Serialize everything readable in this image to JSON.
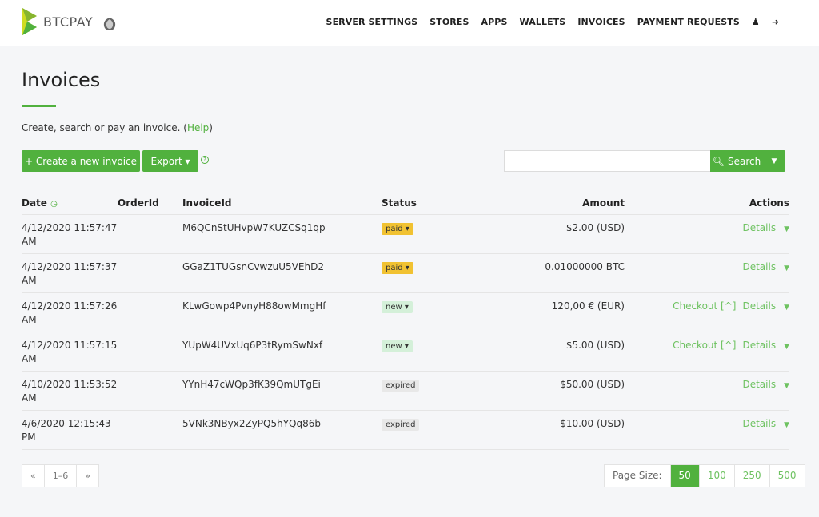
{
  "brand": {
    "name": "BTCPAY"
  },
  "nav": {
    "items": [
      "SERVER SETTINGS",
      "STORES",
      "APPS",
      "WALLETS",
      "INVOICES",
      "PAYMENT REQUESTS"
    ]
  },
  "page": {
    "title": "Invoices",
    "lead": "Create, search or pay an invoice. (",
    "help": "Help",
    "lead_end": ")"
  },
  "toolbar": {
    "create_label": "+ Create a new invoice",
    "export_label": "Export ▾",
    "help_icon": "?",
    "search_label": "Search",
    "search_value": ""
  },
  "table": {
    "headers": {
      "date": "Date",
      "order": "OrderId",
      "invoice": "InvoiceId",
      "status": "Status",
      "amount": "Amount",
      "actions": "Actions"
    },
    "rows": [
      {
        "date": "4/12/2020 11:57:47 AM",
        "order": "",
        "invoice": "M6QCnStUHvpW7KUZCSq1qp",
        "status": "paid",
        "amount": "$2.00 (USD)",
        "checkout": "",
        "details": "Details"
      },
      {
        "date": "4/12/2020 11:57:37 AM",
        "order": "",
        "invoice": "GGaZ1TUGsnCvwzuU5VEhD2",
        "status": "paid",
        "amount": "0.01000000 BTC",
        "checkout": "",
        "details": "Details"
      },
      {
        "date": "4/12/2020 11:57:26 AM",
        "order": "",
        "invoice": "KLwGowp4PvnyH88owMmgHf",
        "status": "new",
        "amount": "120,00 € (EUR)",
        "checkout": "Checkout [^]",
        "details": "Details"
      },
      {
        "date": "4/12/2020 11:57:15 AM",
        "order": "",
        "invoice": "YUpW4UVxUq6P3tRymSwNxf",
        "status": "new",
        "amount": "$5.00 (USD)",
        "checkout": "Checkout [^]",
        "details": "Details"
      },
      {
        "date": "4/10/2020 11:53:52 AM",
        "order": "",
        "invoice": "YYnH47cWQp3fK39QmUTgEi",
        "status": "expired",
        "amount": "$50.00 (USD)",
        "checkout": "",
        "details": "Details"
      },
      {
        "date": "4/6/2020 12:15:43 PM",
        "order": "",
        "invoice": "5VNk3NByx2ZyPQ5hYQq86b",
        "status": "expired",
        "amount": "$10.00 (USD)",
        "checkout": "",
        "details": "Details"
      }
    ]
  },
  "pager": {
    "prev": "«",
    "range": "1–6",
    "next": "»"
  },
  "page_size": {
    "label": "Page Size:",
    "options": [
      "50",
      "100",
      "250",
      "500"
    ],
    "selected": "50"
  },
  "colors": {
    "accent": "#51b13e",
    "paid": "#f1c232",
    "new": "#d4f0d9",
    "expired": "#e8e8e8"
  }
}
